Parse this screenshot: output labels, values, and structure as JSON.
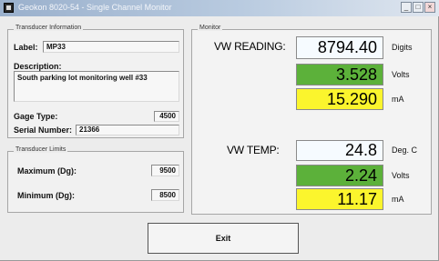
{
  "window": {
    "title": "Geokon 8020-54 - Single Channel Monitor",
    "controls": [
      "_",
      "□",
      "×"
    ]
  },
  "transducer_info": {
    "group_title": "Transducer Information",
    "label_caption": "Label:",
    "label_value": "MP33",
    "description_caption": "Description:",
    "description_value": "South parking lot monitoring well #33",
    "gage_type_caption": "Gage Type:",
    "gage_type_value": "4500",
    "serial_caption": "Serial Number:",
    "serial_value": "21366"
  },
  "transducer_limits": {
    "group_title": "Transducer Limits",
    "max_caption": "Maximum (Dg):",
    "max_value": "9500",
    "min_caption": "Minimum (Dg):",
    "min_value": "8500"
  },
  "monitor": {
    "group_title": "Monitor",
    "vw_reading": {
      "label": "VW READING:",
      "value": "8794.40",
      "value_unit": "Digits",
      "volts": "3.528",
      "volts_unit": "Volts",
      "ma": "15.290",
      "ma_unit": "mA"
    },
    "vw_temp": {
      "label": "VW TEMP:",
      "value": "24.8",
      "value_unit": "Deg. C",
      "volts": "2.24",
      "volts_unit": "Volts",
      "ma": "11.17",
      "ma_unit": "mA"
    }
  },
  "exit_label": "Exit",
  "colors": {
    "volts_fill": "#5cb13a",
    "ma_fill": "#fbf52d",
    "value_fill": "#f6fbff"
  }
}
